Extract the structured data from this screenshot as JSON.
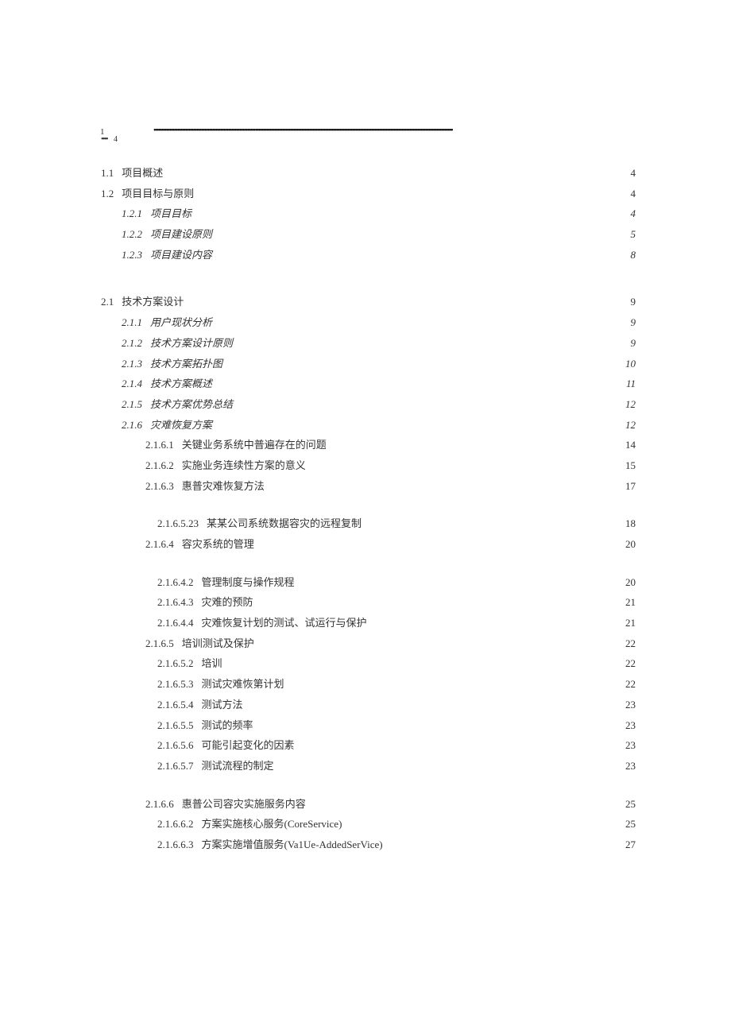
{
  "top": {
    "n1": "1",
    "n4": "4"
  },
  "toc": [
    {
      "indent": "indent-1",
      "num": "1.1",
      "title": "项目概述",
      "leader": "dots",
      "page": "4",
      "italic": false,
      "spacer": null
    },
    {
      "indent": "indent-1",
      "num": "1.2",
      "title": "项目目标与原则",
      "leader": "dots",
      "page": "4",
      "italic": false,
      "spacer": null
    },
    {
      "indent": "indent-2",
      "num": "1.2.1",
      "title": "项目目标",
      "leader": "fine",
      "page": "4",
      "italic": true,
      "spacer": null
    },
    {
      "indent": "indent-2",
      "num": "1.2.2",
      "title": "项目建设原则",
      "leader": "fine",
      "page": "5",
      "italic": true,
      "spacer": null
    },
    {
      "indent": "indent-2",
      "num": "1.2.3",
      "title": "项目建设内容",
      "leader": "fine",
      "page": "8",
      "italic": true,
      "spacer": "spacer-md"
    },
    {
      "indent": "indent-1",
      "num": "2.1",
      "title": "技术方案设计",
      "leader": "dots",
      "page": "9",
      "italic": false,
      "spacer": null
    },
    {
      "indent": "indent-2",
      "num": "2.1.1",
      "title": "用户现状分析",
      "leader": "fine",
      "page": "9",
      "italic": true,
      "spacer": null
    },
    {
      "indent": "indent-2",
      "num": "2.1.2",
      "title": "技术方案设计原则",
      "leader": "fine",
      "page": "9",
      "italic": true,
      "spacer": null
    },
    {
      "indent": "indent-2",
      "num": "2.1.3",
      "title": "技术方案拓扑图",
      "leader": "fine",
      "page": "10",
      "italic": true,
      "spacer": null
    },
    {
      "indent": "indent-2",
      "num": "2.1.4",
      "title": "技术方案概述",
      "leader": "fine",
      "page": "11",
      "italic": true,
      "spacer": null
    },
    {
      "indent": "indent-2",
      "num": "2.1.5",
      "title": "技术方案优势总结",
      "leader": "fine",
      "page": "12",
      "italic": true,
      "spacer": null
    },
    {
      "indent": "indent-2",
      "num": "2.1.6",
      "title": "灾难恢复方案",
      "leader": "fine",
      "page": "12",
      "italic": true,
      "spacer": null
    },
    {
      "indent": "indent-3",
      "num": "2.1.6.1",
      "title": "关键业务系统中普遍存在的问题",
      "leader": "dots",
      "page": "14",
      "italic": false,
      "spacer": null
    },
    {
      "indent": "indent-3",
      "num": "2.1.6.2",
      "title": "实施业务连续性方案的意义",
      "leader": "dots",
      "page": "15",
      "italic": false,
      "spacer": null
    },
    {
      "indent": "indent-3",
      "num": "2.1.6.3",
      "title": "惠普灾难恢复方法",
      "leader": "dots",
      "page": "17",
      "italic": false,
      "spacer": "spacer-sm"
    },
    {
      "indent": "indent-4",
      "num": "2.1.6.5.23",
      "title": "某某公司系统数据容灾的远程复制",
      "leader": "dots",
      "page": "18",
      "italic": false,
      "spacer": null
    },
    {
      "indent": "indent-3",
      "num": "2.1.6.4",
      "title": "容灾系统的管理",
      "leader": "dots",
      "page": "20",
      "italic": false,
      "spacer": "spacer-sm"
    },
    {
      "indent": "indent-4",
      "num": "2.1.6.4.2",
      "title": "管理制度与操作规程",
      "leader": "dots",
      "page": "20",
      "italic": false,
      "spacer": null
    },
    {
      "indent": "indent-4",
      "num": "2.1.6.4.3",
      "title": "灾难的预防",
      "leader": "dots",
      "page": "21",
      "italic": false,
      "spacer": null
    },
    {
      "indent": "indent-4",
      "num": "2.1.6.4.4",
      "title": "灾难恢复计划的测试、试运行与保护",
      "leader": "dots",
      "page": "21",
      "italic": false,
      "spacer": null
    },
    {
      "indent": "indent-3",
      "num": "2.1.6.5",
      "title": "培训测试及保护",
      "leader": "dots",
      "page": "22",
      "italic": false,
      "spacer": null
    },
    {
      "indent": "indent-4",
      "num": "2.1.6.5.2",
      "title": "培训",
      "leader": "dots",
      "page": "22",
      "italic": false,
      "spacer": null
    },
    {
      "indent": "indent-4",
      "num": "2.1.6.5.3",
      "title": "测试灾难恢第计划",
      "leader": "dots",
      "page": "22",
      "italic": false,
      "spacer": null
    },
    {
      "indent": "indent-4",
      "num": "2.1.6.5.4",
      "title": "测试方法",
      "leader": "dots",
      "page": "23",
      "italic": false,
      "spacer": null
    },
    {
      "indent": "indent-4",
      "num": "2.1.6.5.5",
      "title": "测试的频率",
      "leader": "dots",
      "page": "23",
      "italic": false,
      "spacer": null
    },
    {
      "indent": "indent-4",
      "num": "2.1.6.5.6",
      "title": "可能引起变化的因素",
      "leader": "dots",
      "page": "23",
      "italic": false,
      "spacer": null
    },
    {
      "indent": "indent-4",
      "num": "2.1.6.5.7",
      "title": "测试流程的制定",
      "leader": "dots",
      "page": "23",
      "italic": false,
      "spacer": "spacer-sm"
    },
    {
      "indent": "indent-3",
      "num": "2.1.6.6",
      "title": "惠普公司容灾实施服务内容",
      "leader": "dots",
      "page": "25",
      "italic": false,
      "spacer": null
    },
    {
      "indent": "indent-4",
      "num": "2.1.6.6.2",
      "title": "方案实施核心服务(CoreService)",
      "leader": "fine",
      "page": "25",
      "italic": false,
      "spacer": null
    },
    {
      "indent": "indent-4",
      "num": "2.1.6.6.3",
      "title": "方案实施增值服务(Va1Ue-AddedSerVice)",
      "leader": "fine",
      "page": "27",
      "italic": false,
      "spacer": null
    }
  ]
}
